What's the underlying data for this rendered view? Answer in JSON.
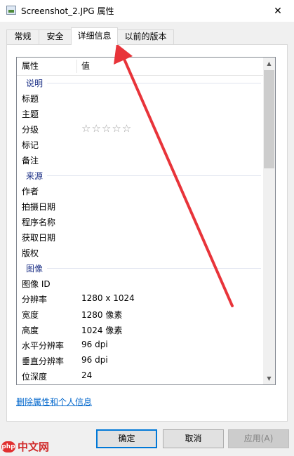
{
  "window": {
    "title": "Screenshot_2.JPG 属性",
    "close_glyph": "✕"
  },
  "tabs": [
    {
      "label": "常规"
    },
    {
      "label": "安全"
    },
    {
      "label": "详细信息"
    },
    {
      "label": "以前的版本"
    }
  ],
  "active_tab": "详细信息",
  "list": {
    "headers": {
      "property": "属性",
      "value": "值"
    },
    "groups": [
      {
        "name": "说明",
        "rows": [
          {
            "k": "标题",
            "v": ""
          },
          {
            "k": "主题",
            "v": ""
          },
          {
            "k": "分级",
            "v": "",
            "rating": "☆☆☆☆☆"
          },
          {
            "k": "标记",
            "v": ""
          },
          {
            "k": "备注",
            "v": ""
          }
        ]
      },
      {
        "name": "来源",
        "rows": [
          {
            "k": "作者",
            "v": ""
          },
          {
            "k": "拍摄日期",
            "v": ""
          },
          {
            "k": "程序名称",
            "v": ""
          },
          {
            "k": "获取日期",
            "v": ""
          },
          {
            "k": "版权",
            "v": ""
          }
        ]
      },
      {
        "name": "图像",
        "rows": [
          {
            "k": "图像 ID",
            "v": ""
          },
          {
            "k": "分辨率",
            "v": "1280 x 1024"
          },
          {
            "k": "宽度",
            "v": "1280 像素"
          },
          {
            "k": "高度",
            "v": "1024 像素"
          },
          {
            "k": "水平分辨率",
            "v": "96 dpi"
          },
          {
            "k": "垂直分辨率",
            "v": "96 dpi"
          },
          {
            "k": "位深度",
            "v": "24"
          }
        ]
      }
    ]
  },
  "remove_link": "删除属性和个人信息",
  "buttons": {
    "ok": "确定",
    "cancel": "取消",
    "apply": "应用(A)"
  },
  "watermark": {
    "logo": "php",
    "text": "中文网"
  },
  "colors": {
    "group_header": "#1e3287",
    "link": "#0066cc",
    "annotation": "#e8343a"
  }
}
